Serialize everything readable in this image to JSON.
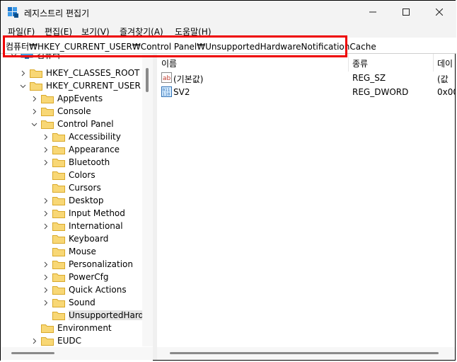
{
  "window": {
    "title": "레지스트리 편집기"
  },
  "menu": [
    "파일(F)",
    "편집(E)",
    "보기(V)",
    "즐겨찾기(A)",
    "도움말(H)"
  ],
  "address": {
    "path": "컴퓨터₩HKEY_CURRENT_USER₩Control Panel₩UnsupportedHardwareNotificationCache"
  },
  "tree": {
    "root": "컴퓨터",
    "hives": [
      "HKEY_CLASSES_ROOT",
      "HKEY_CURRENT_USER"
    ],
    "hkcu_children_top": [
      "AppEvents",
      "Console",
      "Control Panel"
    ],
    "control_panel_children": [
      "Accessibility",
      "Appearance",
      "Bluetooth",
      "Colors",
      "Cursors",
      "Desktop",
      "Input Method",
      "International",
      "Keyboard",
      "Mouse",
      "Personalization",
      "PowerCfg",
      "Quick Actions",
      "Sound",
      "UnsupportedHardw"
    ],
    "hkcu_children_bottom": [
      "Environment",
      "EUDC"
    ]
  },
  "list": {
    "headers": {
      "name": "이름",
      "type": "종류",
      "data": "데이"
    },
    "rows": [
      {
        "name": "(기본값)",
        "type": "REG_SZ",
        "data": "(값"
      },
      {
        "name": "SV2",
        "type": "REG_DWORD",
        "data": "0x00"
      }
    ]
  },
  "colors": {
    "highlight_box": "#e00000",
    "folder": "#f8d775",
    "accent": "#0078d4"
  }
}
